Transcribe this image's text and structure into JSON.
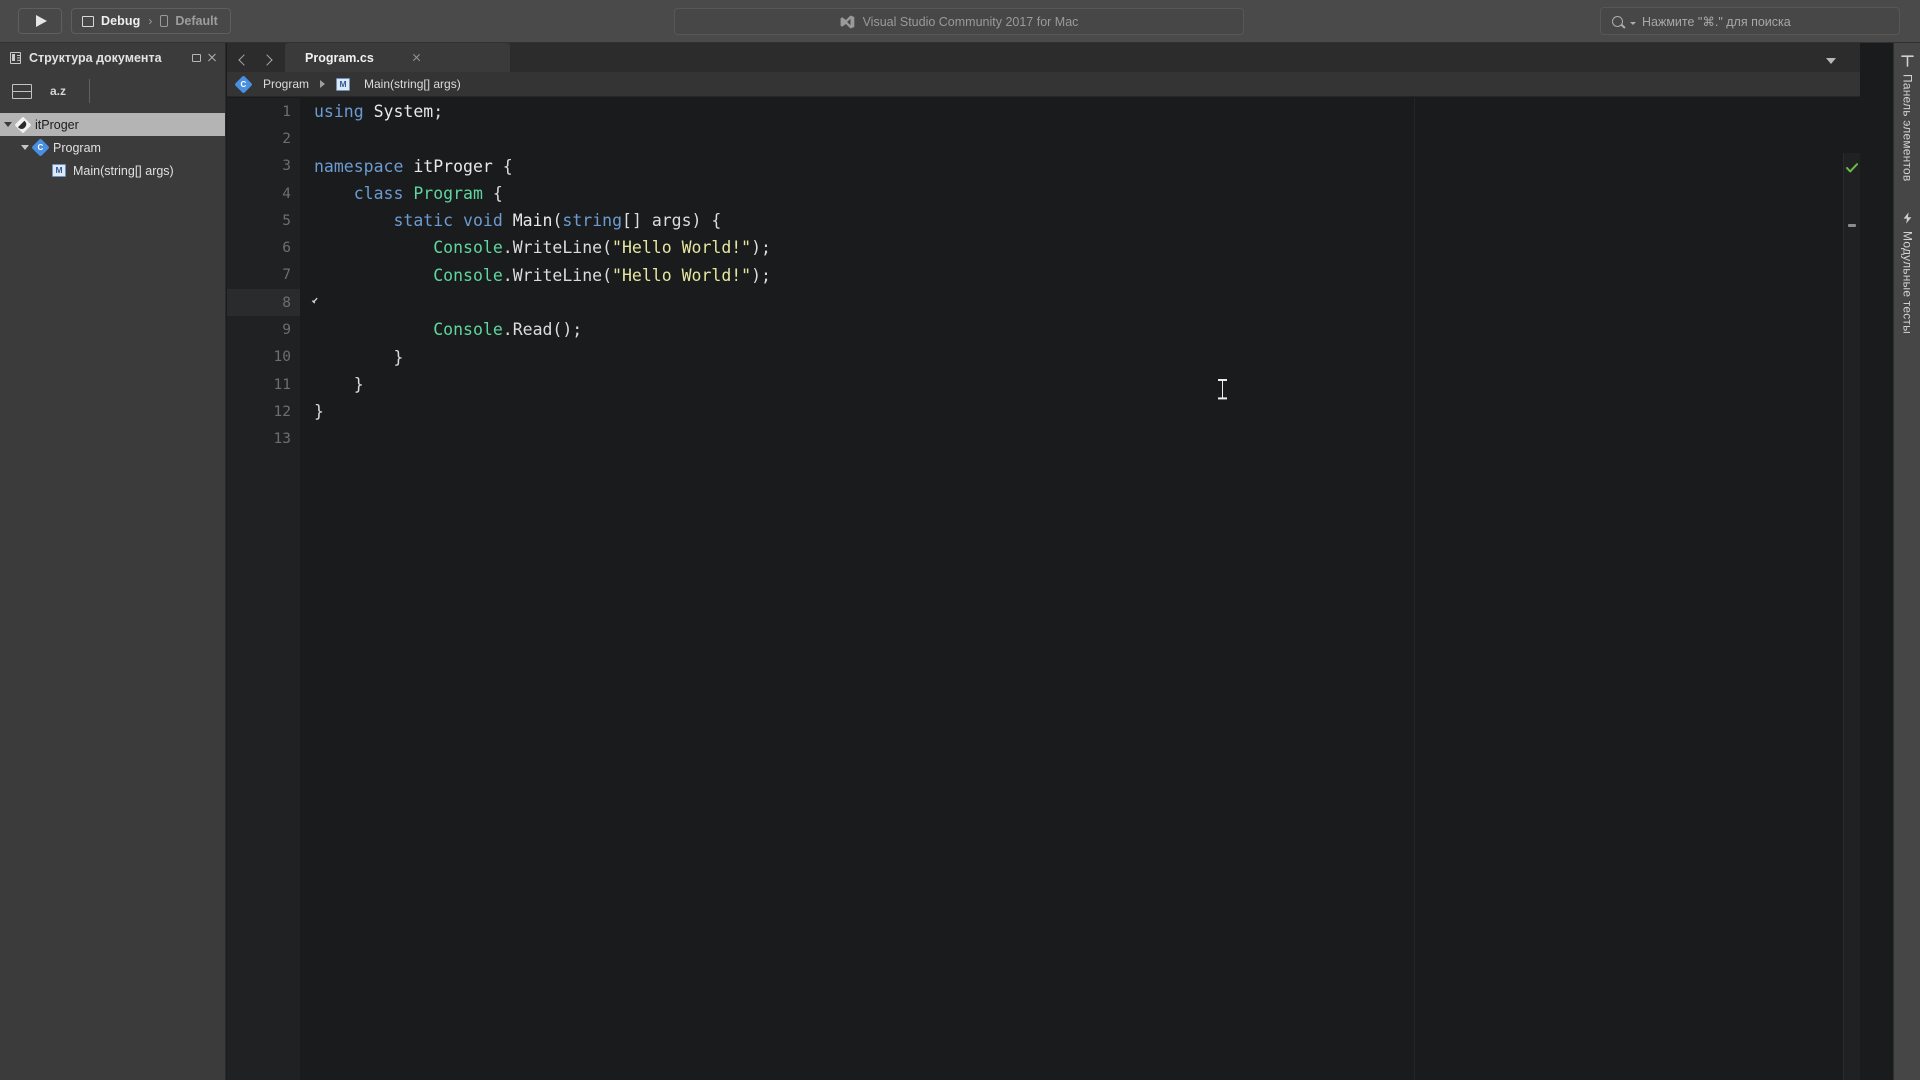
{
  "toolbar": {
    "run_button": {
      "name": "run-button",
      "icon": "play-icon"
    },
    "configuration": {
      "build_config": "Debug",
      "separator": "›",
      "device": "Default",
      "build_icon": "window-icon",
      "device_icon": "device-icon"
    },
    "title_bar": {
      "app_title": "Visual Studio Community 2017 for Mac",
      "icon": "visual-studio-logo"
    },
    "search": {
      "placeholder": "Нажмите \"⌘.\" для поиска",
      "icon": "search-icon"
    }
  },
  "document_outline": {
    "title": "Структура документа",
    "title_icon": "document-outline-icon",
    "window_button": "restore-window-icon",
    "close_button": "close-icon",
    "toolbar": {
      "group_button": "group-icon",
      "sort_label": "a.z"
    },
    "tree": [
      {
        "label": "itProger",
        "icon": "namespace-icon",
        "icon_letter": "",
        "indent": 0,
        "selected": true,
        "expanded": true
      },
      {
        "label": "Program",
        "icon": "class-icon",
        "icon_letter": "C",
        "indent": 1,
        "selected": false,
        "expanded": true
      },
      {
        "label": "Main(string[] args)",
        "icon": "method-icon",
        "icon_letter": "M",
        "indent": 2,
        "selected": false,
        "expanded": false
      }
    ]
  },
  "editor": {
    "nav_back": "chevron-left-icon",
    "nav_forward": "chevron-right-icon",
    "tabs": [
      {
        "label": "Program.cs",
        "active": true,
        "close_icon": "close-icon"
      }
    ],
    "tab_list_button": "chevron-down-icon",
    "breadcrumb": [
      {
        "label": "Program",
        "icon": "class-icon",
        "icon_letter": "C"
      },
      {
        "label": "Main(string[] args)",
        "icon": "method-icon",
        "icon_letter": "M"
      }
    ],
    "filename": "Program.cs",
    "current_line": 8,
    "quickfix_icon": "quickfix-screwdriver-icon",
    "mouse_cursor": "text-ibeam-cursor",
    "overview": {
      "status_icon": "green-checkmark-icon",
      "status_color": "#6bbd45",
      "marker_icon": "collapse-marker-icon"
    },
    "line_count": 13,
    "lines": [
      {
        "n": 1,
        "tokens": [
          {
            "t": "using",
            "c": "k"
          },
          {
            "t": " ",
            "c": "pl"
          },
          {
            "t": "System",
            "c": "id"
          },
          {
            "t": ";",
            "c": "pl"
          }
        ]
      },
      {
        "n": 2,
        "tokens": []
      },
      {
        "n": 3,
        "tokens": [
          {
            "t": "namespace",
            "c": "k"
          },
          {
            "t": " ",
            "c": "pl"
          },
          {
            "t": "itProger",
            "c": "id"
          },
          {
            "t": " {",
            "c": "pl"
          }
        ]
      },
      {
        "n": 4,
        "tokens": [
          {
            "t": "    ",
            "c": "pl"
          },
          {
            "t": "class",
            "c": "k"
          },
          {
            "t": " ",
            "c": "pl"
          },
          {
            "t": "Program",
            "c": "ty"
          },
          {
            "t": " {",
            "c": "pl"
          }
        ]
      },
      {
        "n": 5,
        "tokens": [
          {
            "t": "        ",
            "c": "pl"
          },
          {
            "t": "static",
            "c": "k"
          },
          {
            "t": " ",
            "c": "pl"
          },
          {
            "t": "void",
            "c": "k"
          },
          {
            "t": " ",
            "c": "pl"
          },
          {
            "t": "Main",
            "c": "id"
          },
          {
            "t": "(",
            "c": "pl"
          },
          {
            "t": "string",
            "c": "k"
          },
          {
            "t": "[] args) {",
            "c": "pl"
          }
        ]
      },
      {
        "n": 6,
        "tokens": [
          {
            "t": "            ",
            "c": "pl"
          },
          {
            "t": "Console",
            "c": "ty"
          },
          {
            "t": ".WriteLine(",
            "c": "pl"
          },
          {
            "t": "\"Hello World!\"",
            "c": "st"
          },
          {
            "t": ");",
            "c": "pl"
          }
        ]
      },
      {
        "n": 7,
        "tokens": [
          {
            "t": "            ",
            "c": "pl"
          },
          {
            "t": "Console",
            "c": "ty"
          },
          {
            "t": ".WriteLine(",
            "c": "pl"
          },
          {
            "t": "\"Hello World!\"",
            "c": "st"
          },
          {
            "t": ");",
            "c": "pl"
          }
        ]
      },
      {
        "n": 8,
        "tokens": []
      },
      {
        "n": 9,
        "tokens": [
          {
            "t": "            ",
            "c": "pl"
          },
          {
            "t": "Console",
            "c": "ty"
          },
          {
            "t": ".Read();",
            "c": "pl"
          }
        ]
      },
      {
        "n": 10,
        "tokens": [
          {
            "t": "        }",
            "c": "pl"
          }
        ]
      },
      {
        "n": 11,
        "tokens": [
          {
            "t": "    }",
            "c": "pl"
          }
        ]
      },
      {
        "n": 12,
        "tokens": [
          {
            "t": "}",
            "c": "pl"
          }
        ]
      },
      {
        "n": 13,
        "tokens": []
      }
    ]
  },
  "right_pads": [
    {
      "label": "Панель элементов",
      "icon": "toolbox-icon"
    },
    {
      "label": "Модульные тесты",
      "icon": "lightning-icon"
    }
  ],
  "colors": {
    "toolbar_bg": "#4a4a4a",
    "pad_bg": "#3b3b3b",
    "editor_bg": "#1a1b1c",
    "gutter_bg": "#202123",
    "tab_active_bg": "#3a3a3a",
    "keyword": "#6c9bd2",
    "type": "#5fd6a0",
    "string": "#e6e6a0",
    "plain": "#dcdcdc",
    "selection": "#b4b4b4",
    "accent_blue": "#4a90e2",
    "success_green": "#6bbd45"
  }
}
